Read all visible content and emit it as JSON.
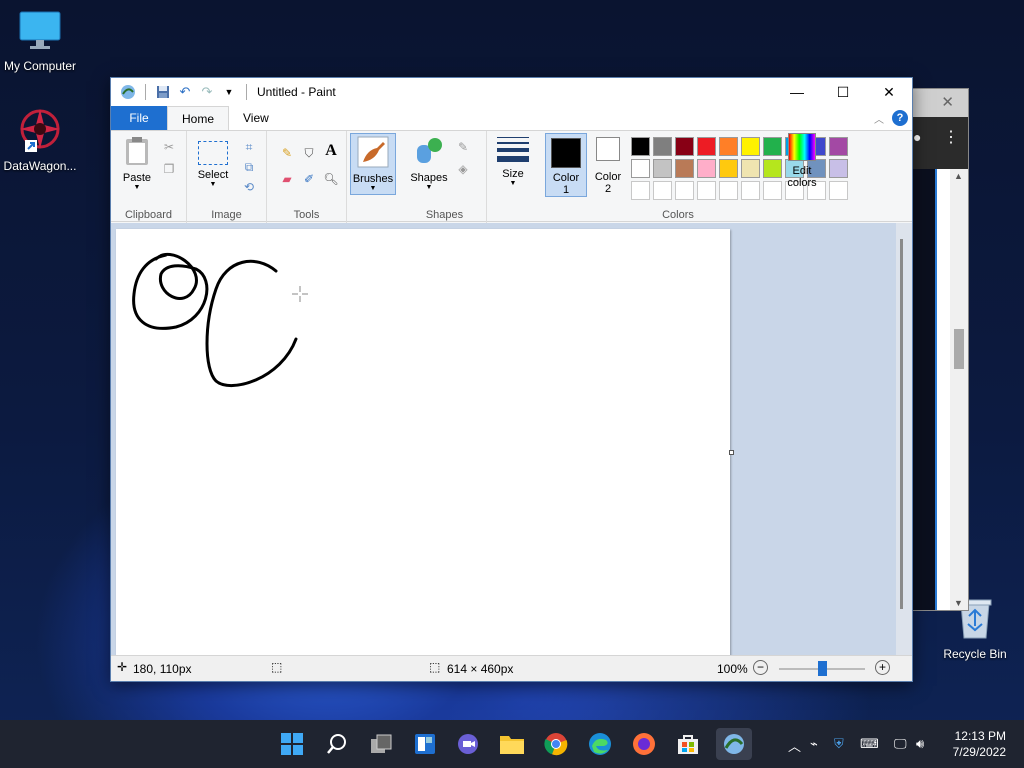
{
  "desktop": {
    "icons": [
      {
        "label": "My Computer"
      },
      {
        "label": "DataWagon..."
      },
      {
        "label": "Recycle Bin"
      }
    ]
  },
  "window": {
    "title": "Untitled - Paint"
  },
  "tabs": [
    {
      "label": "File"
    },
    {
      "label": "Home"
    },
    {
      "label": "View"
    }
  ],
  "ribbon": {
    "clipboard": {
      "group": "Clipboard",
      "paste": "Paste"
    },
    "image": {
      "group": "Image",
      "select": "Select"
    },
    "tools": {
      "group": "Tools",
      "text_glyph": "A"
    },
    "brushes": {
      "label": "Brushes"
    },
    "shapes": {
      "group": "Shapes",
      "label": "Shapes"
    },
    "size": {
      "label": "Size"
    },
    "colors": {
      "group": "Colors",
      "color1": "Color",
      "color1_num": "1",
      "color2": "Color",
      "color2_num": "2",
      "edit": "Edit",
      "edit2": "colors",
      "color1_value": "#000000",
      "color2_value": "#ffffff",
      "row1": [
        "#000000",
        "#7f7f7f",
        "#880015",
        "#ed1c24",
        "#ff7f27",
        "#fff200",
        "#22b14c",
        "#00a2e8",
        "#3f48cc",
        "#a349a4"
      ],
      "row2": [
        "#ffffff",
        "#c3c3c3",
        "#b97a57",
        "#ffaec9",
        "#ffc90e",
        "#efe4b0",
        "#b5e61d",
        "#99d9ea",
        "#7092be",
        "#c8bfe7"
      ],
      "row3": [
        "#ffffff",
        "#ffffff",
        "#ffffff",
        "#ffffff",
        "#ffffff",
        "#ffffff",
        "#ffffff",
        "#ffffff",
        "#ffffff",
        "#ffffff"
      ]
    }
  },
  "status": {
    "cursor": "180, 110px",
    "size": "614 × 460px",
    "zoom": "100%",
    "zoom_level": 0.5
  },
  "clock": {
    "time": "12:13 PM",
    "date": "7/29/2022"
  }
}
